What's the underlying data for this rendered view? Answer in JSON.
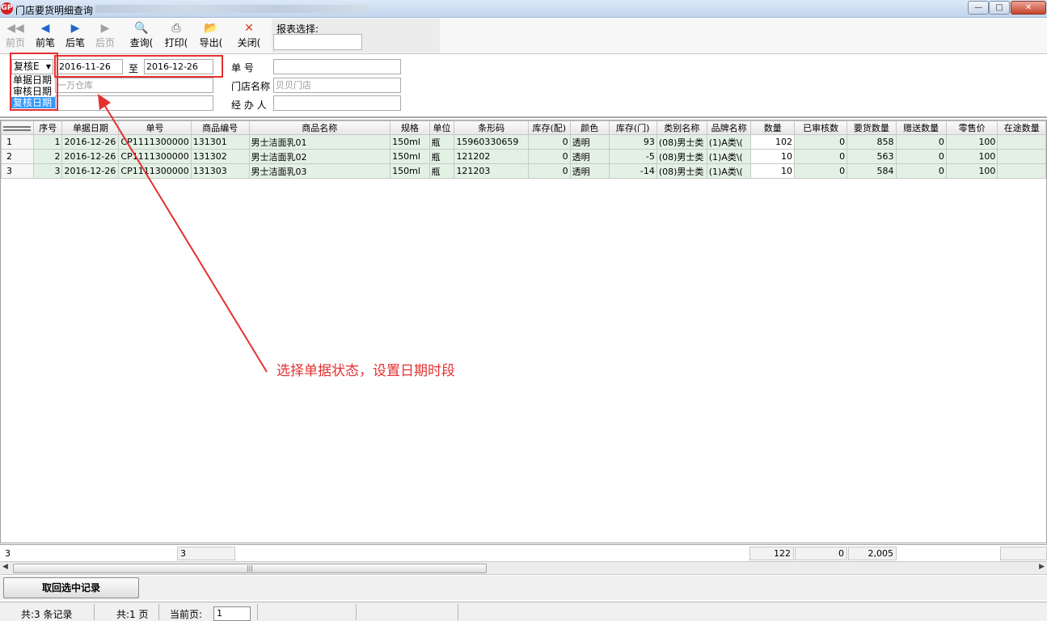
{
  "window": {
    "title": "门店要货明细查询",
    "logo_text": "GP",
    "minimize": "—",
    "maximize": "□",
    "close": "✕"
  },
  "toolbar": {
    "first_page": "前页",
    "prev_record": "前笔",
    "next_record": "后笔",
    "last_page": "后页",
    "query": "查询(",
    "print": "打印(",
    "export": "导出(",
    "close": "关闭(",
    "report_label": "报表选择:",
    "report_value": ""
  },
  "filters": {
    "status_select": "复核E",
    "status_options": [
      "单据日期",
      "审核日期",
      "复核日期"
    ],
    "date_from": "2016-11-26",
    "date_to_label": "至",
    "date_to": "2016-12-26",
    "warehouse_placeholder": "一万仓库",
    "doc_no_label": "单    号",
    "doc_no_value": "",
    "store_label": "门店名称",
    "store_placeholder": "贝贝门店",
    "handler_label": "经 办 人",
    "handler_value": ""
  },
  "grid": {
    "columns": [
      "序号",
      "单据日期",
      "单号",
      "商品编号",
      "商品名称",
      "规格",
      "单位",
      "条形码",
      "库存(配)",
      "颜色",
      "库存(门)",
      "类别名称",
      "品牌名称",
      "数量",
      "已审核数",
      "要货数量",
      "赠送数量",
      "零售价",
      "在途数量"
    ],
    "rows": [
      {
        "rownum": "1",
        "seq": "1",
        "date": "2016-12-26",
        "doc_no": "CP1111300000",
        "code": "131301",
        "name": "男士洁面乳01",
        "spec": "150ml",
        "unit": "瓶",
        "barcode": "15960330659",
        "stock_dc": "0",
        "color": "透明",
        "stock_store": "93",
        "category": "(08)男士类",
        "brand": "(1)A类\\(",
        "qty": "102",
        "approved": "0",
        "request_qty": "858",
        "gift_qty": "0",
        "price": "100",
        "transit": ""
      },
      {
        "rownum": "2",
        "seq": "2",
        "date": "2016-12-26",
        "doc_no": "CP1111300000",
        "code": "131302",
        "name": "男士洁面乳02",
        "spec": "150ml",
        "unit": "瓶",
        "barcode": "121202",
        "stock_dc": "0",
        "color": "透明",
        "stock_store": "-5",
        "category": "(08)男士类",
        "brand": "(1)A类\\(",
        "qty": "10",
        "approved": "0",
        "request_qty": "563",
        "gift_qty": "0",
        "price": "100",
        "transit": ""
      },
      {
        "rownum": "3",
        "seq": "3",
        "date": "2016-12-26",
        "doc_no": "CP1111300000",
        "code": "131303",
        "name": "男士洁面乳03",
        "spec": "150ml",
        "unit": "瓶",
        "barcode": "121203",
        "stock_dc": "0",
        "color": "透明",
        "stock_store": "-14",
        "category": "(08)男士类",
        "brand": "(1)A类\\(",
        "qty": "10",
        "approved": "0",
        "request_qty": "584",
        "gift_qty": "0",
        "price": "100",
        "transit": ""
      }
    ]
  },
  "summary": {
    "row_count": "3",
    "code_count": "3",
    "qty_total": "122",
    "approved_total": "0",
    "request_total": "2,005"
  },
  "scroll": {
    "left": "◀",
    "thumb": "|||",
    "right": "▶"
  },
  "actions": {
    "retrieve": "取回选中记录"
  },
  "status": {
    "records": "共:3 条记录",
    "pages": "共:1 页",
    "current_label": "当前页:",
    "current_page": "1"
  },
  "annotation": {
    "text": "选择单据状态，设置日期时段",
    "color": "#e53030"
  },
  "icons": [
    "first-page-icon",
    "prev-record-icon",
    "next-record-icon",
    "last-page-icon",
    "query-icon",
    "print-icon",
    "export-icon",
    "close-icon"
  ]
}
